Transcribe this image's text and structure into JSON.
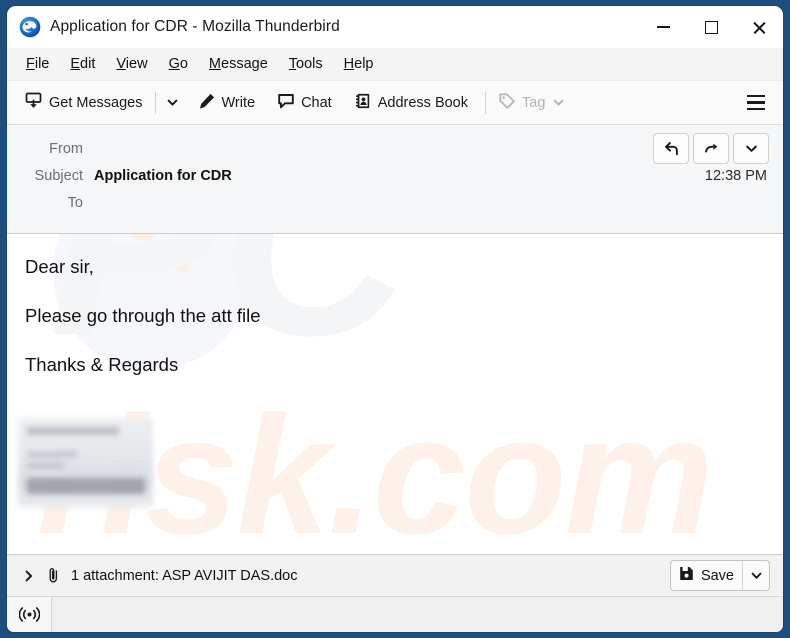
{
  "window": {
    "title": "Application for CDR - Mozilla Thunderbird",
    "app_icon": "thunderbird-logo-icon",
    "controls": {
      "minimize": "minimize-icon",
      "maximize": "maximize-icon",
      "close": "close-icon"
    }
  },
  "menubar": {
    "items": [
      {
        "label": "File",
        "accesskey": "F"
      },
      {
        "label": "Edit",
        "accesskey": "E"
      },
      {
        "label": "View",
        "accesskey": "V"
      },
      {
        "label": "Go",
        "accesskey": "G"
      },
      {
        "label": "Message",
        "accesskey": "M"
      },
      {
        "label": "Tools",
        "accesskey": "T"
      },
      {
        "label": "Help",
        "accesskey": "H"
      }
    ]
  },
  "toolbar": {
    "get_messages": "Get Messages",
    "get_messages_icon": "inbox-download-icon",
    "get_messages_caret": "chevron-down-icon",
    "write": "Write",
    "write_icon": "pencil-icon",
    "chat": "Chat",
    "chat_icon": "speech-bubble-icon",
    "address_book": "Address Book",
    "address_book_icon": "address-book-icon",
    "tag": "Tag",
    "tag_icon": "tag-icon",
    "tag_caret": "chevron-down-icon",
    "tag_disabled": true,
    "app_menu_icon": "hamburger-menu-icon"
  },
  "message": {
    "from_label": "From",
    "from_value": "",
    "subject_label": "Subject",
    "subject_value": "Application for CDR",
    "to_label": "To",
    "to_value": "",
    "time": "12:38 PM",
    "actions": {
      "reply": "reply-icon",
      "forward": "forward-icon",
      "more": "chevron-down-icon"
    },
    "body_lines": [
      "Dear sir,",
      "Please go through the att file",
      "Thanks & Regards"
    ],
    "signature_redacted": true
  },
  "attachments": {
    "expand_icon": "chevron-right-icon",
    "paperclip_icon": "paperclip-icon",
    "summary": "1 attachment: ASP AVIJIT DAS.doc",
    "count": 1,
    "filename": "ASP AVIJIT DAS.doc",
    "save_label": "Save",
    "save_icon": "save-file-icon",
    "save_caret": "chevron-down-icon"
  },
  "statusbar": {
    "connection_icon": "online-status-icon",
    "text": ""
  },
  "watermark": {
    "top_text": "PC",
    "bottom_text": "risk.com"
  },
  "colors": {
    "window_border": "#1d4e7e",
    "titlebar_bg": "#ffffff",
    "menubar_bg": "#f4f4f4",
    "toolbar_bg": "#fafafa",
    "header_bg": "#f5f6f7",
    "body_bg": "#ffffff",
    "attachbar_bg": "#f2f2f2",
    "statusbar_bg": "#efefef",
    "text_primary": "#111111",
    "text_muted": "#6b6f73",
    "disabled": "#b3b3b3",
    "watermark_peach": "#fdf1e9"
  }
}
